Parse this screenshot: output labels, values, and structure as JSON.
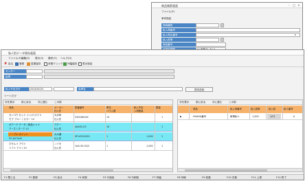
{
  "search_dialog": {
    "title": "商品検索画面",
    "section": "ファイル(F)",
    "group_label": "条件指定",
    "rows": [
      {
        "label": "検索種別"
      },
      {
        "label": "私入荷番号"
      },
      {
        "label": "私人荷台番号"
      },
      {
        "label": "私入前単"
      },
      {
        "label": "商品番号"
      },
      {
        "label": "状態別種類",
        "value": "0:(未掲示しない)"
      }
    ],
    "checkbox_label": "期限切れ日時経過のみ(非表示しない)",
    "buttons": {
      "search": "検索実行",
      "close": "閉じる"
    }
  },
  "main_window": {
    "title": "私人別データ保存画面",
    "menu": [
      "ファイル(F)",
      "編集(E)",
      "表示(V)",
      "操作(O)",
      "ヘルプ(H)"
    ],
    "toolbar": [
      "戻る",
      "登録",
      "変更保存",
      "状態クリック",
      "列幅保存",
      "表示追加"
    ],
    "header_fields": {
      "sender_label": "センター",
      "owner_label": "倉庫",
      "date_label": "私入予定日付",
      "date_value": "2024/01/31",
      "name_label": "倉庫名",
      "button": "見本送信"
    },
    "pane_label": "ソートだけ",
    "left_grid": {
      "nav": [
        "次を表示",
        "前に戻る",
        "次に進む",
        "この前"
      ],
      "headers": [
        "商品",
        "メーカー",
        "型番番号",
        "単位",
        "私入予定",
        "数量"
      ],
      "subheaders": [
        "",
        "仕入先",
        "",
        "バラ入数",
        "入荷数量",
        ""
      ],
      "rows": [
        {
          "name": "センコウ セット シン/パスワ 2",
          "name2": "モプ ブルー / カラー 10",
          "vendor": "大手商",
          "vendor2": "仕入先",
          "code": "5300481XX",
          "unit": "10",
          "qty": "1",
          "amt": "1"
        },
        {
          "name": "ボアーテ データ / 新品シャツ",
          "name2": "アーズ / ダーク 10",
          "vendor": "ベアー",
          "vendor2": "仕入先",
          "code": "4A402-03",
          "unit": "10",
          "qty": "1",
          "amt": "1"
        },
        {
          "name": "ノーブル ポイット",
          "name2": "VC-b/C0x/0",
          "vendor": "大大通",
          "vendor2": "仕入先",
          "code": "SP-VIC01030",
          "unit": "1",
          "qty": "1,000",
          "amt": "1"
        },
        {
          "name": "ホモルバ アウト",
          "name2": "ソフト アツ / 10",
          "vendor": "ノバモ",
          "vendor2": "仕入先",
          "code": "1AA 00-02/2",
          "unit": "1",
          "qty": "1,000",
          "amt": "1"
        }
      ]
    },
    "right_grid": {
      "nav": [
        "次を表示",
        "前に戻る",
        "次に進む",
        "この前"
      ],
      "headers": [
        "商品",
        "私入荷番号",
        "私入前単",
        "私入前",
        "私人番号"
      ],
      "row": {
        "arrow": "▶",
        "name": "HHAHA番号",
        "code": "新規私人",
        "qty": "1,000",
        "date": "1/31",
        "mark": "A"
      }
    },
    "footer": [
      "F1 閉じる",
      "F2 登録",
      "F3 戻る",
      "F4 状態",
      "F5 行追加",
      "F6 行削除",
      "F7 列幅",
      "F8 印刷",
      "F9 前頁",
      "F10 次頁",
      "F11 上書",
      "F12 終了"
    ]
  }
}
